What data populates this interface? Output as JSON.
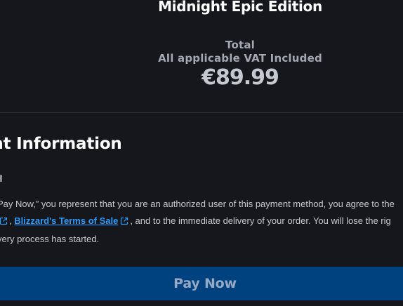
{
  "product": {
    "title": "Midnight Epic Edition"
  },
  "summary": {
    "total_label": "Total",
    "vat_label": "All applicable VAT Included",
    "price": "€89.99"
  },
  "payment": {
    "heading": "ent Information",
    "method_label": "H",
    "terms": {
      "line1": "Pay Now,” you represent that you are an authorized user of this payment method, you agree to the",
      "line2_prefix": ",",
      "link_label": "Blizzard's Terms of Sale",
      "line2_suffix": ", and to the immediate delivery of your order. You will lose the rig",
      "line3": "very process has started."
    },
    "pay_button_label": "Pay Now"
  },
  "colors": {
    "background": "#15171d",
    "link": "#2d9cff",
    "button": "#00427f"
  },
  "icons": {
    "external_link": "external-link-icon"
  }
}
